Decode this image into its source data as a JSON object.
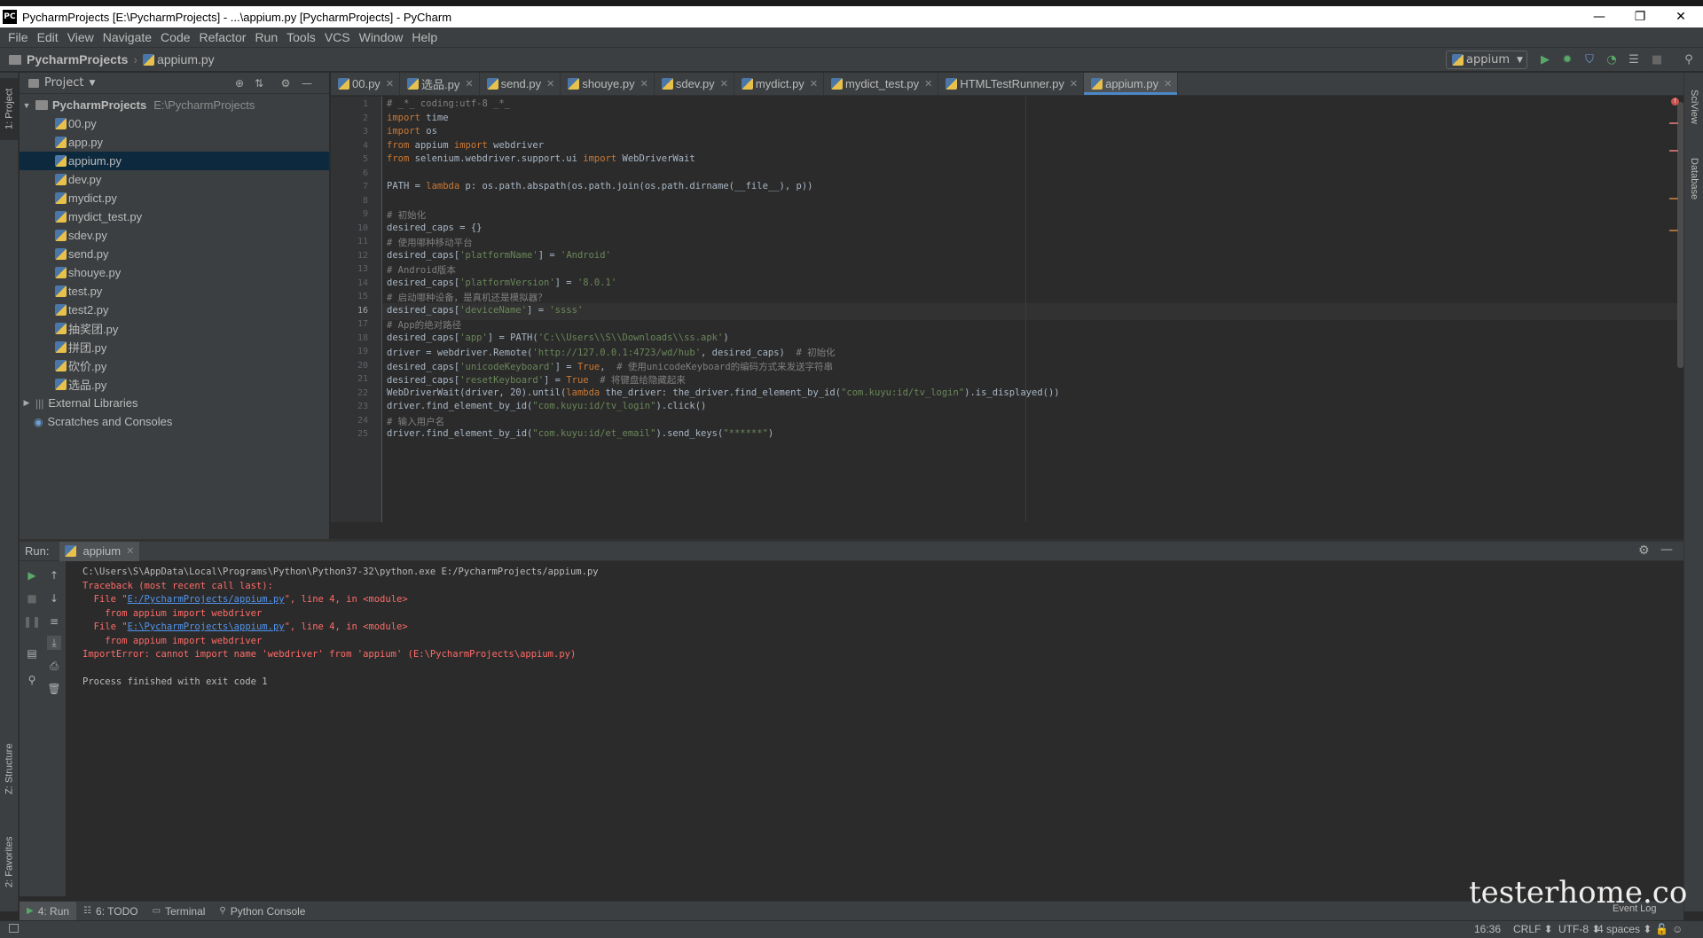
{
  "window": {
    "title": "PycharmProjects [E:\\PycharmProjects] - ...\\appium.py [PycharmProjects] - PyCharm",
    "logo": "PC",
    "minimize": "—",
    "maximize": "❐",
    "close": "✕"
  },
  "menu": [
    "File",
    "Edit",
    "View",
    "Navigate",
    "Code",
    "Refactor",
    "Run",
    "Tools",
    "VCS",
    "Window",
    "Help"
  ],
  "breadcrumb": {
    "project": "PycharmProjects",
    "file": "appium.py"
  },
  "run_config": {
    "label": "appium"
  },
  "left_strip": {
    "project_tab": "1: Project",
    "structure_tab": "Z: Structure",
    "favorites_tab": "2: Favorites"
  },
  "right_strip": {
    "sciview_tab": "SciView",
    "database_tab": "Database"
  },
  "project_panel": {
    "title": "Project",
    "root_name": "PycharmProjects",
    "root_path": "E:\\PycharmProjects",
    "files": [
      "00.py",
      "app.py",
      "appium.py",
      "dev.py",
      "mydict.py",
      "mydict_test.py",
      "sdev.py",
      "send.py",
      "shouye.py",
      "test.py",
      "test2.py",
      "抽奖团.py",
      "拼团.py",
      "砍价.py",
      "选品.py"
    ],
    "selected_index": 2,
    "external_libraries": "External Libraries",
    "scratches": "Scratches and Consoles"
  },
  "editor_tabs": [
    "00.py",
    "选品.py",
    "send.py",
    "shouye.py",
    "sdev.py",
    "mydict.py",
    "mydict_test.py",
    "HTMLTestRunner.py",
    "appium.py"
  ],
  "active_tab_index": 8,
  "code_lines": [
    {
      "n": "1",
      "segs": [
        [
          "cm",
          "# _*_ coding:utf-8 _*_"
        ]
      ]
    },
    {
      "n": "2",
      "segs": [
        [
          "kw",
          "import"
        ],
        [
          "pl",
          " time"
        ]
      ]
    },
    {
      "n": "3",
      "segs": [
        [
          "kw",
          "import"
        ],
        [
          "pl",
          " os"
        ]
      ]
    },
    {
      "n": "4",
      "segs": [
        [
          "kw",
          "from"
        ],
        [
          "pl",
          " appium "
        ],
        [
          "kw",
          "import"
        ],
        [
          "pl",
          " webdriver"
        ]
      ]
    },
    {
      "n": "5",
      "segs": [
        [
          "kw",
          "from"
        ],
        [
          "pl",
          " selenium.webdriver.support.ui "
        ],
        [
          "kw",
          "import"
        ],
        [
          "pl",
          " WebDriverWait"
        ]
      ]
    },
    {
      "n": "6",
      "segs": []
    },
    {
      "n": "7",
      "segs": [
        [
          "pl",
          "PATH = "
        ],
        [
          "kw",
          "lambda"
        ],
        [
          "pl",
          " p: os.path.abspath(os.path.join(os.path.dirname(__file__), p))"
        ]
      ]
    },
    {
      "n": "8",
      "segs": []
    },
    {
      "n": "9",
      "segs": [
        [
          "cm",
          "# 初始化"
        ]
      ]
    },
    {
      "n": "10",
      "segs": [
        [
          "pl",
          "desired_caps = {}"
        ]
      ]
    },
    {
      "n": "11",
      "segs": [
        [
          "cm",
          "# 使用哪种移动平台"
        ]
      ]
    },
    {
      "n": "12",
      "segs": [
        [
          "pl",
          "desired_caps["
        ],
        [
          "st",
          "'platformName'"
        ],
        [
          "pl",
          "] = "
        ],
        [
          "st",
          "'Android'"
        ]
      ]
    },
    {
      "n": "13",
      "segs": [
        [
          "cm",
          "# Android版本"
        ]
      ]
    },
    {
      "n": "14",
      "segs": [
        [
          "pl",
          "desired_caps["
        ],
        [
          "st",
          "'platformVersion'"
        ],
        [
          "pl",
          "] = "
        ],
        [
          "st",
          "'8.0.1'"
        ]
      ]
    },
    {
      "n": "15",
      "segs": [
        [
          "cm",
          "# 启动哪种设备，是真机还是模拟器？"
        ]
      ]
    },
    {
      "n": "16",
      "segs": [
        [
          "pl",
          "desired_caps["
        ],
        [
          "st",
          "'deviceName'"
        ],
        [
          "pl",
          "] = "
        ],
        [
          "st",
          "'ssss'"
        ]
      ]
    },
    {
      "n": "17",
      "segs": [
        [
          "cm",
          "# App的绝对路径"
        ]
      ]
    },
    {
      "n": "18",
      "segs": [
        [
          "pl",
          "desired_caps["
        ],
        [
          "st",
          "'app'"
        ],
        [
          "pl",
          "] = PATH("
        ],
        [
          "st",
          "'C:\\\\Users\\\\S\\\\Downloads\\\\ss.apk'"
        ],
        [
          "pl",
          ")"
        ]
      ]
    },
    {
      "n": "19",
      "segs": [
        [
          "pl",
          "driver = webdriver.Remote("
        ],
        [
          "st",
          "'http://127.0.0.1:4723/wd/hub'"
        ],
        [
          "pl",
          ", desired_caps)  "
        ],
        [
          "cm",
          "# 初始化"
        ]
      ]
    },
    {
      "n": "20",
      "segs": [
        [
          "pl",
          "desired_caps["
        ],
        [
          "st",
          "'unicodeKeyboard'"
        ],
        [
          "pl",
          "] = "
        ],
        [
          "kw",
          "True"
        ],
        [
          "pl",
          ",  "
        ],
        [
          "cm",
          "# 使用unicodeKeyboard的编码方式来发送字符串"
        ]
      ]
    },
    {
      "n": "21",
      "segs": [
        [
          "pl",
          "desired_caps["
        ],
        [
          "st",
          "'resetKeyboard'"
        ],
        [
          "pl",
          "] = "
        ],
        [
          "kw",
          "True"
        ],
        [
          "pl",
          "  "
        ],
        [
          "cm",
          "# 将键盘给隐藏起来"
        ]
      ]
    },
    {
      "n": "22",
      "segs": [
        [
          "pl",
          "WebDriverWait(driver, 20).until("
        ],
        [
          "kw",
          "lambda"
        ],
        [
          "pl",
          " the_driver: the_driver.find_element_by_id("
        ],
        [
          "st",
          "\"com.kuyu:id/tv_login\""
        ],
        [
          "pl",
          ").is_displayed())"
        ]
      ]
    },
    {
      "n": "23",
      "segs": [
        [
          "pl",
          "driver.find_element_by_id("
        ],
        [
          "st",
          "\"com.kuyu:id/tv_login\""
        ],
        [
          "pl",
          ").click()"
        ]
      ]
    },
    {
      "n": "24",
      "segs": [
        [
          "cm",
          "# 输入用户名"
        ]
      ]
    },
    {
      "n": "25",
      "segs": [
        [
          "pl",
          "driver.find_element_by_id("
        ],
        [
          "st",
          "\"com.kuyu:id/et_email\""
        ],
        [
          "pl",
          ").send_keys("
        ],
        [
          "st",
          "\"******\""
        ],
        [
          "pl",
          ")"
        ]
      ]
    }
  ],
  "current_line": 16,
  "run_panel": {
    "label": "Run:",
    "tab": "appium",
    "console": [
      {
        "cls": "grey",
        "text": "C:\\Users\\S\\AppData\\Local\\Programs\\Python\\Python37-32\\python.exe E:/PycharmProjects/appium.py"
      },
      {
        "cls": "red",
        "text": "Traceback (most recent call last):"
      },
      {
        "cls": "red",
        "pre": "  File \"",
        "link": "E:/PycharmProjects/appium.py",
        "post": "\", line 4, in <module>"
      },
      {
        "cls": "red",
        "text": "    from appium import webdriver"
      },
      {
        "cls": "red",
        "pre": "  File \"",
        "link": "E:\\PycharmProjects\\appium.py",
        "post": "\", line 4, in <module>"
      },
      {
        "cls": "red",
        "text": "    from appium import webdriver"
      },
      {
        "cls": "red",
        "text": "ImportError: cannot import name 'webdriver' from 'appium' (E:\\PycharmProjects\\appium.py)"
      },
      {
        "cls": "grey",
        "text": ""
      },
      {
        "cls": "grey",
        "text": "Process finished with exit code 1"
      }
    ]
  },
  "bottom_tabs": [
    "4: Run",
    "6: TODO",
    "Terminal",
    "Python Console"
  ],
  "status": {
    "position": "16:36",
    "line_sep": "CRLF ⬍",
    "encoding": "UTF-8 ⬍",
    "indent": "4 spaces ⬍",
    "event_log": "Event Log"
  },
  "watermark": "testerhome.com",
  "colors": {
    "accent": "#4a88c7",
    "keyword": "#cc7832",
    "string": "#6a8759",
    "comment": "#808080",
    "error": "#ff6b68",
    "selection": "#0d293e",
    "run_green": "#59a869"
  }
}
